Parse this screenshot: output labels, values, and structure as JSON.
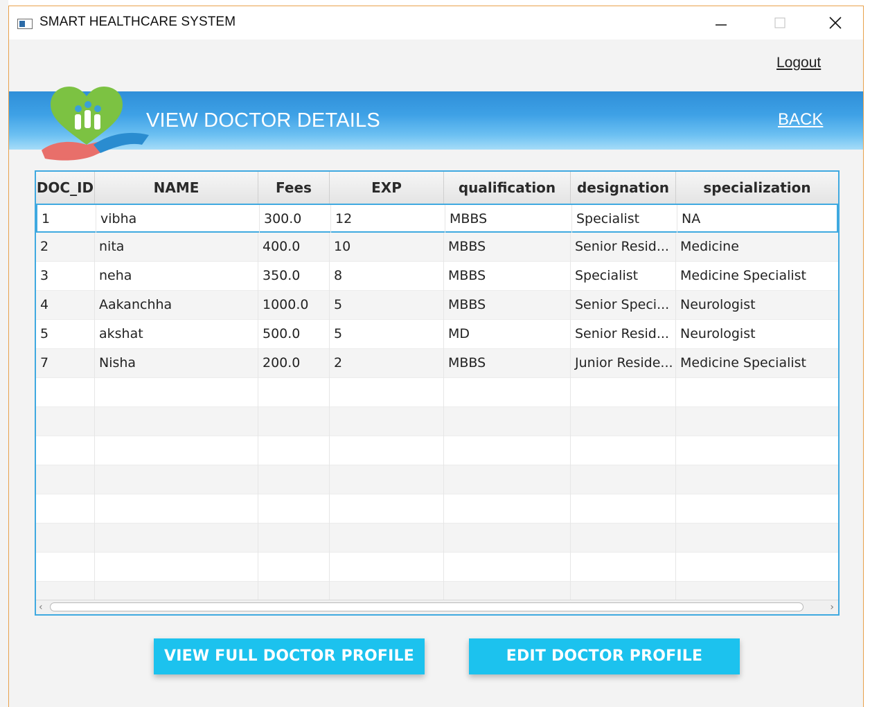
{
  "window": {
    "title": "SMART HEALTHCARE SYSTEM",
    "controls": {
      "minimize": "—",
      "maximize": "☐",
      "close": "✕"
    }
  },
  "header": {
    "logout_label": "Logout",
    "banner_title": "VIEW DOCTOR DETAILS",
    "back_label": "BACK"
  },
  "table": {
    "columns": [
      "DOC_ID",
      "NAME",
      "Fees",
      "EXP",
      "qualification",
      "designation",
      "specialization"
    ],
    "rows": [
      [
        "1",
        "vibha",
        "300.0",
        "12",
        "MBBS",
        "Specialist",
        "NA"
      ],
      [
        "2",
        "nita",
        "400.0",
        "10",
        "MBBS",
        "Senior Resid...",
        "Medicine"
      ],
      [
        "3",
        "neha",
        "350.0",
        "8",
        "MBBS",
        "Specialist",
        "Medicine Specialist"
      ],
      [
        "4",
        "Aakanchha",
        "1000.0",
        "5",
        "MBBS",
        "Senior Speci...",
        "Neurologist"
      ],
      [
        "5",
        "akshat",
        "500.0",
        "5",
        "MD",
        "Senior Resid...",
        "Neurologist"
      ],
      [
        "7",
        "Nisha",
        "200.0",
        "2",
        "MBBS",
        "Junior Reside...",
        "Medicine Specialist"
      ]
    ],
    "selected_row": 0,
    "scroll_left_arrow": "‹",
    "scroll_right_arrow": "›"
  },
  "actions": {
    "view_label": "VIEW FULL DOCTOR PROFILE",
    "edit_label": "EDIT DOCTOR PROFILE"
  },
  "colors": {
    "banner": "#3ea1e6",
    "button": "#1cc2ee",
    "table_border": "#3fa9e0"
  }
}
